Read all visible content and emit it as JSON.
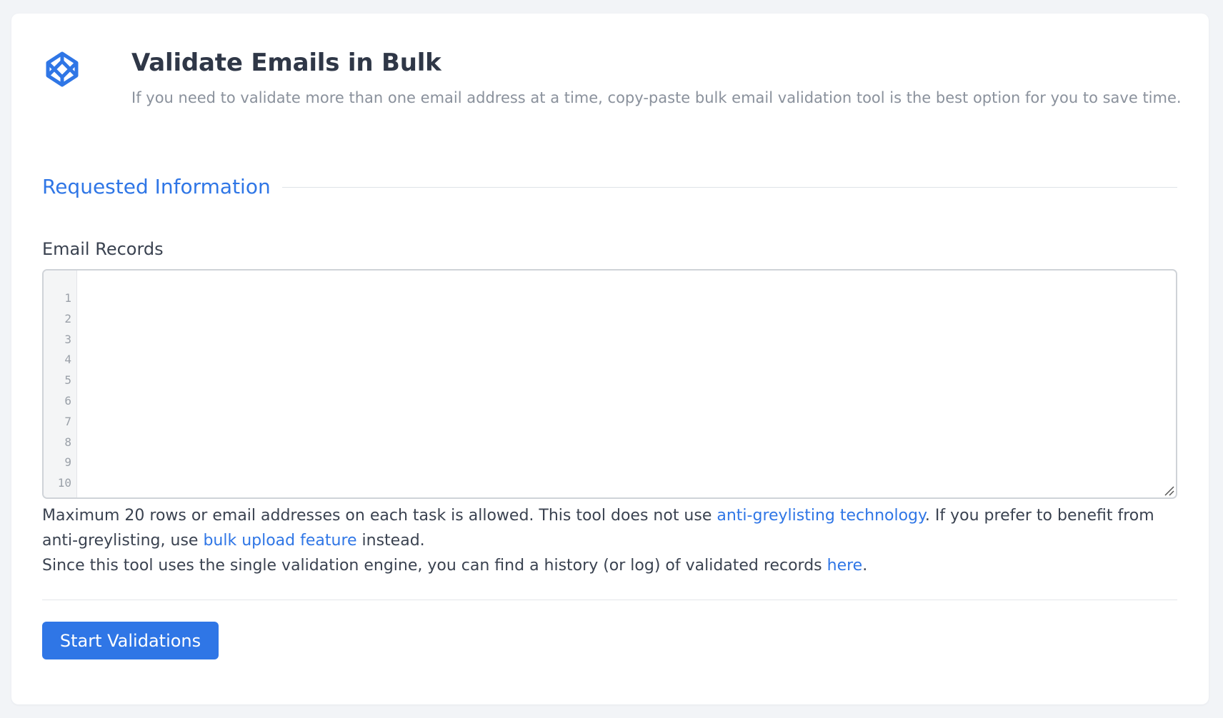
{
  "header": {
    "icon": "codepen-cube-icon",
    "title": "Validate Emails in Bulk",
    "subtitle": "If you need to validate more than one email address at a time, copy-paste bulk email validation tool is the best option for you to save time."
  },
  "section": {
    "title": "Requested Information"
  },
  "form": {
    "label": "Email Records",
    "value": "",
    "line_numbers": [
      "1",
      "2",
      "3",
      "4",
      "5",
      "6",
      "7",
      "8",
      "9",
      "10"
    ]
  },
  "help": {
    "p1_a": "Maximum 20 rows or email addresses on each task is allowed. This tool does not use ",
    "link1": "anti-greylisting technology",
    "p1_b": ". If you prefer to benefit from anti-greylisting, use ",
    "link2": "bulk upload feature",
    "p1_c": " instead.",
    "p2_a": "Since this tool uses the single validation engine, you can find a history (or log) of validated records ",
    "link3": "here",
    "p2_b": "."
  },
  "actions": {
    "submit_label": "Start Validations"
  },
  "colors": {
    "accent": "#2f76e6",
    "background": "#f2f4f7",
    "title": "#2f3747",
    "muted": "#8a919c"
  }
}
